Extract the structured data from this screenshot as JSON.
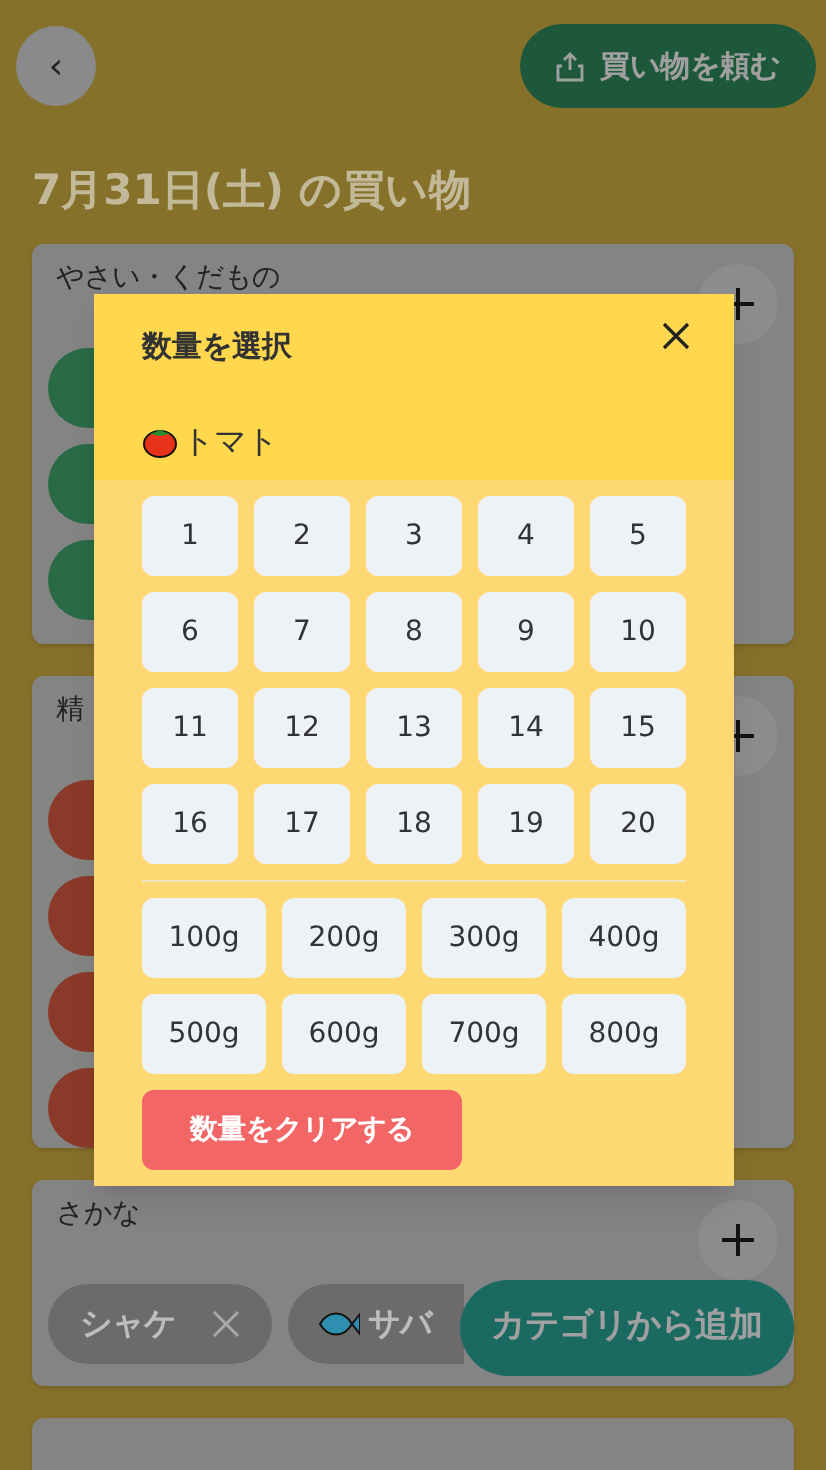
{
  "header": {
    "back_label": "‹",
    "share_label": "買い物を頼む"
  },
  "title": "7月31日(土) の買い物",
  "categories": [
    {
      "name": "やさい・くだもの",
      "chips": [
        {
          "color": "#2a6a45"
        },
        {
          "color": "#2a6a45"
        },
        {
          "color": "#2a6a45"
        }
      ]
    },
    {
      "name": "精",
      "chips": [
        {
          "color": "#8b3a29"
        },
        {
          "color": "#8b3a29"
        },
        {
          "color": "#8b3a29"
        },
        {
          "color": "#8b3a29"
        }
      ]
    },
    {
      "name": "さかな",
      "chips": [
        {
          "label": "シャケ",
          "kind": "plain",
          "cut": false
        },
        {
          "label": "サバ",
          "kind": "fish",
          "cut": true
        }
      ]
    }
  ],
  "modal": {
    "title": "数量を選択",
    "item": "トマト",
    "counts": [
      "1",
      "2",
      "3",
      "4",
      "5",
      "6",
      "7",
      "8",
      "9",
      "10",
      "11",
      "12",
      "13",
      "14",
      "15",
      "16",
      "17",
      "18",
      "19",
      "20"
    ],
    "grams": [
      "100g",
      "200g",
      "300g",
      "400g",
      "500g",
      "600g",
      "700g",
      "800g"
    ],
    "clear_label": "数量をクリアする"
  },
  "fab": {
    "label": "カテゴリから追加"
  }
}
